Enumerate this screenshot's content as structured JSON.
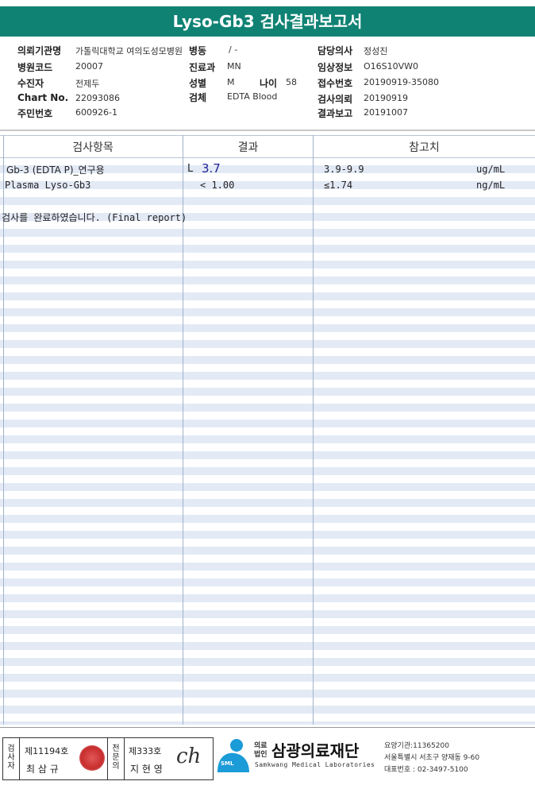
{
  "title": "Lyso-Gb3 검사결과보고서",
  "info": {
    "left": [
      {
        "label": "의뢰기관명",
        "value": "가톨릭대학교 여의도성모병원"
      },
      {
        "label": "병원코드",
        "value": "20007"
      },
      {
        "label": "수진자",
        "value": "전제두"
      },
      {
        "label": "Chart No.",
        "value": "22093086"
      },
      {
        "label": "주민번호",
        "value": "600926-1"
      }
    ],
    "middle": [
      {
        "label": "병동",
        "value": "/ -"
      },
      {
        "label": "진료과",
        "value": "MN"
      },
      {
        "label": "성별",
        "value": "M"
      },
      {
        "label": "검체",
        "value": "EDTA Blood"
      }
    ],
    "age": {
      "label": "나이",
      "value": "58"
    },
    "right": [
      {
        "label": "담당의사",
        "value": "정성진"
      },
      {
        "label": "임상정보",
        "value": "O16S10VW0"
      },
      {
        "label": "접수번호",
        "value": "20190919-35080"
      },
      {
        "label": "검사의뢰",
        "value": "20190919"
      },
      {
        "label": "결과보고",
        "value": "20191007"
      }
    ]
  },
  "table": {
    "headers": [
      "검사항목",
      "결과",
      "참고치"
    ],
    "rows": [
      {
        "item": "Gb-3 (EDTA P)_연구용",
        "flag": "L",
        "result": "3.7",
        "ref": "3.9-9.9",
        "unit": "ug/mL"
      },
      {
        "item": "Plasma Lyso-Gb3",
        "flag": "",
        "result": "< 1.00",
        "ref": "≤1.74",
        "unit": "ng/mL"
      }
    ],
    "note": "검사를  완료하였습니다. (Final report)"
  },
  "footer": {
    "inspector_label": "검사자",
    "inspector_license": "제11194호",
    "inspector_name": "최 삼 규",
    "specialist_label": "전문의",
    "specialist_license": "제333호",
    "specialist_name": "지 현 영",
    "signature": "ch",
    "logo_small": "SML",
    "org_prefix_1": "의료",
    "org_prefix_2": "법인",
    "org_name": "삼광의료재단",
    "org_english": "Samkwang Medical Laboratories",
    "code": "요양기관:11365200",
    "address": "서울특별시 서초구 양재동 9-60",
    "phone": "대표번호 : 02-3497-5100"
  },
  "colors": {
    "title_bg": "#0f8274",
    "stripe": "#e3eaf6",
    "flag": "#1d1d8f"
  }
}
